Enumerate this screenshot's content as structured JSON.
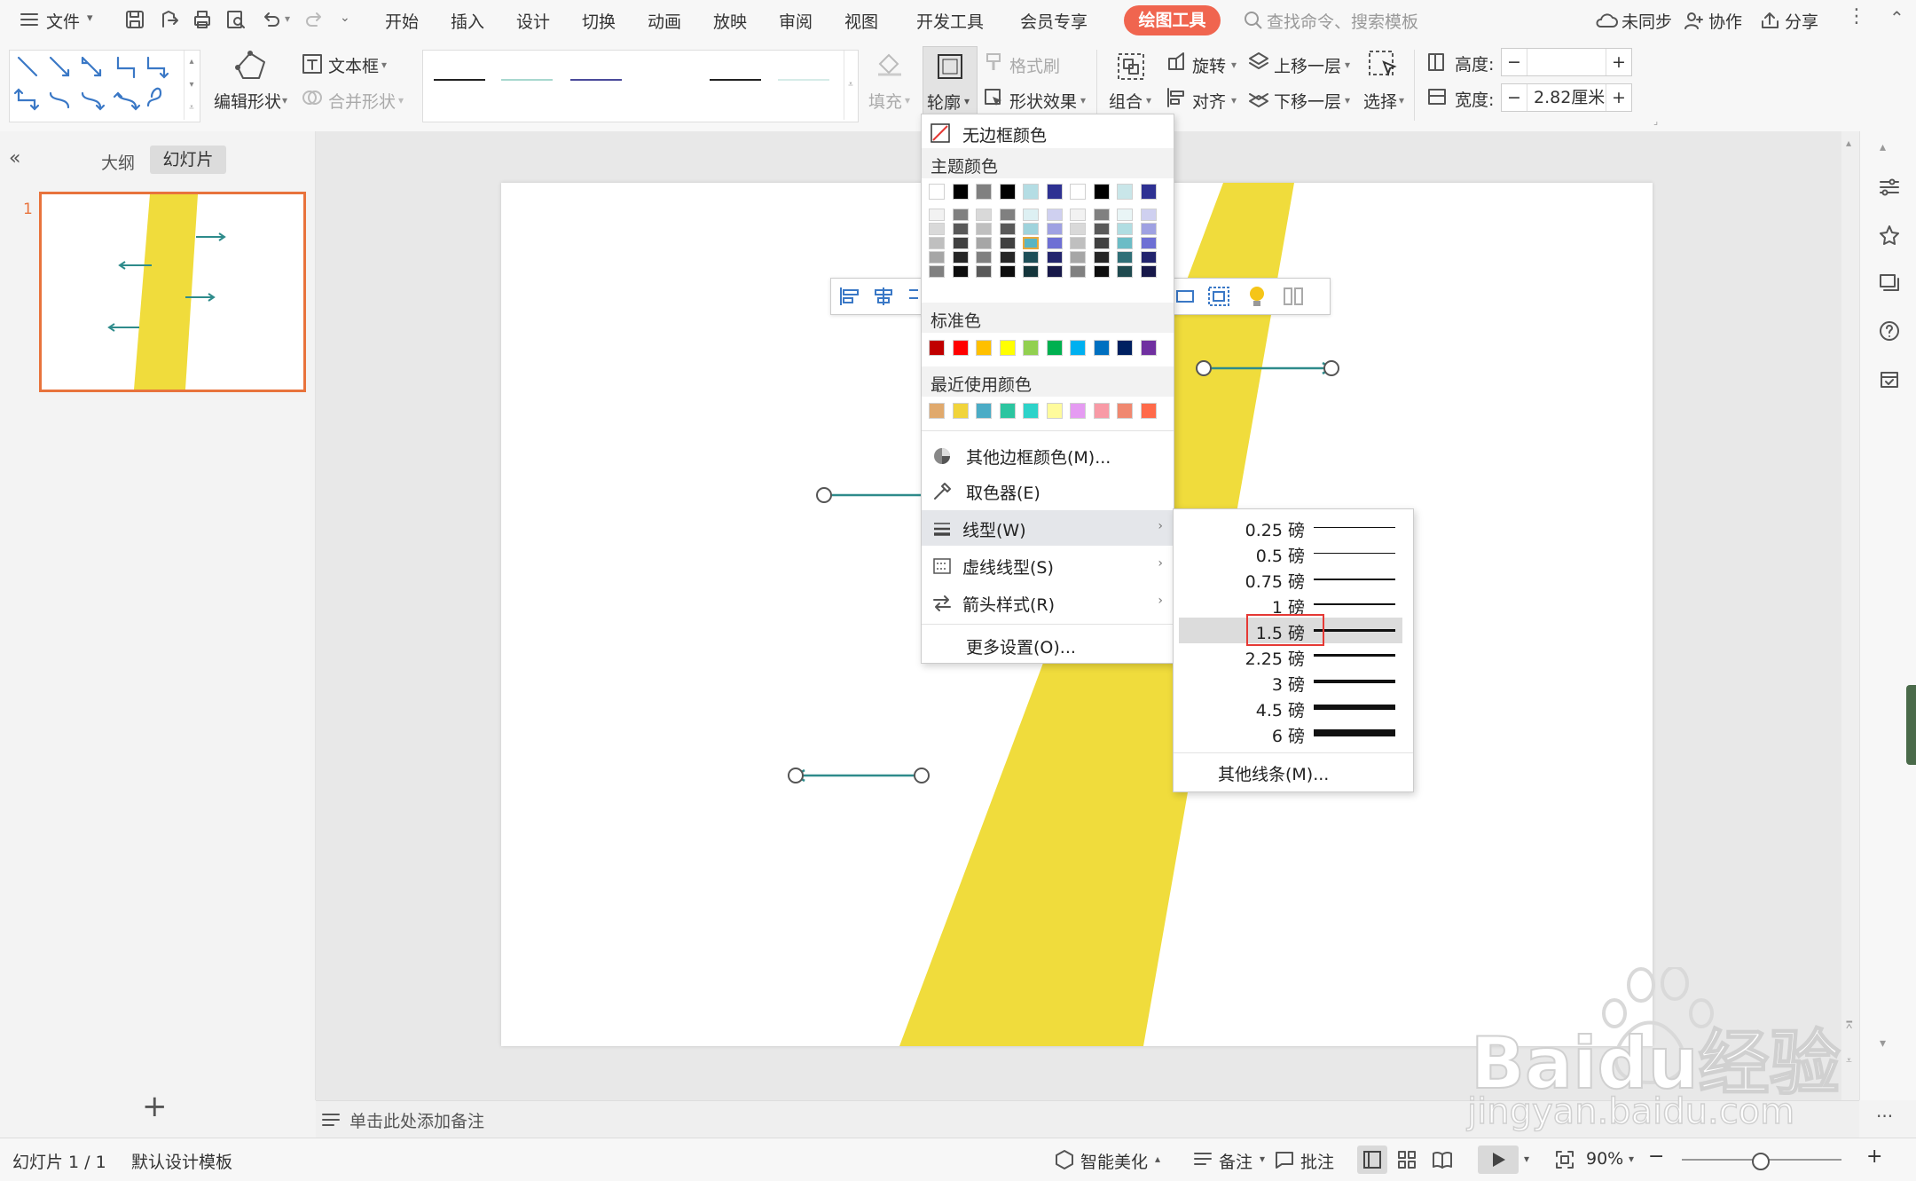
{
  "menubar": {
    "file_label": "文件",
    "tabs": [
      "开始",
      "插入",
      "设计",
      "切换",
      "动画",
      "放映",
      "审阅",
      "视图",
      "开发工具",
      "会员专享"
    ],
    "active_tab": "绘图工具",
    "search_placeholder": "查找命令、搜索模板",
    "sync": "未同步",
    "collab": "协作",
    "share": "分享"
  },
  "ribbon": {
    "edit_shape": "编辑形状",
    "text_box": "文本框",
    "merge_shape": "合并形状",
    "fill": "填充",
    "outline": "轮廓",
    "format_brush": "格式刷",
    "shape_effect": "形状效果",
    "group": "组合",
    "rotate": "旋转",
    "align": "对齐",
    "bring_forward": "上移一层",
    "send_backward": "下移一层",
    "select": "选择",
    "height_label": "高度:",
    "height_value": "",
    "width_label": "宽度:",
    "width_value": "2.82厘米",
    "minus": "−",
    "plus": "+"
  },
  "left_panel": {
    "tab_outline": "大纲",
    "tab_slides": "幻灯片",
    "slide_number": "1",
    "add": "+"
  },
  "dropdown": {
    "no_border": "无边框颜色",
    "theme_colors": "主题颜色",
    "standard_colors": "标准色",
    "recent_colors": "最近使用颜色",
    "more_colors": "其他边框颜色(M)...",
    "eyedropper": "取色器(E)",
    "line_style": "线型(W)",
    "dash_style": "虚线线型(S)",
    "arrow_style": "箭头样式(R)",
    "more_settings": "更多设置(O)...",
    "theme_top_row": [
      "#ffffff",
      "#000000",
      "#808080",
      "#000000",
      "#b4dde4",
      "#2e3192",
      "#ffffff",
      "#000000",
      "#c9e6e9",
      "#2e3192"
    ],
    "standard_row": [
      "#c00000",
      "#ff0000",
      "#ffc000",
      "#ffff00",
      "#92d050",
      "#00b050",
      "#00b0f0",
      "#0070c0",
      "#002060",
      "#7030a0"
    ],
    "recent_row": [
      "#e0a96d",
      "#f1d43b",
      "#4bacc6",
      "#2cc5a0",
      "#2ed3c9",
      "#fffb9c",
      "#e59bf2",
      "#f89aa6",
      "#f08870",
      "#ff6a4a"
    ]
  },
  "submenu": {
    "weights": [
      "0.25 磅",
      "0.5 磅",
      "0.75 磅",
      "1 磅",
      "1.5 磅",
      "2.25 磅",
      "3 磅",
      "4.5 磅",
      "6 磅"
    ],
    "selected": "1.5 磅",
    "more_lines": "其他线条(M)..."
  },
  "notes": {
    "placeholder": "单击此处添加备注"
  },
  "status": {
    "slide_count": "幻灯片 1 / 1",
    "template": "默认设计模板",
    "beautify": "智能美化",
    "notes": "备注",
    "comment": "批注",
    "zoom": "90%",
    "zoom_minus": "−",
    "zoom_plus": "+",
    "more": "···"
  },
  "watermark": {
    "brand": "Baidu经验",
    "url": "jingyan.baidu.com"
  },
  "colors": {
    "accent": "#f0654f",
    "shape_yellow": "#f0dc3c",
    "arrow_teal": "#2e8b8b",
    "highlight_red": "#e53935",
    "thumb_border": "#e8733c"
  }
}
